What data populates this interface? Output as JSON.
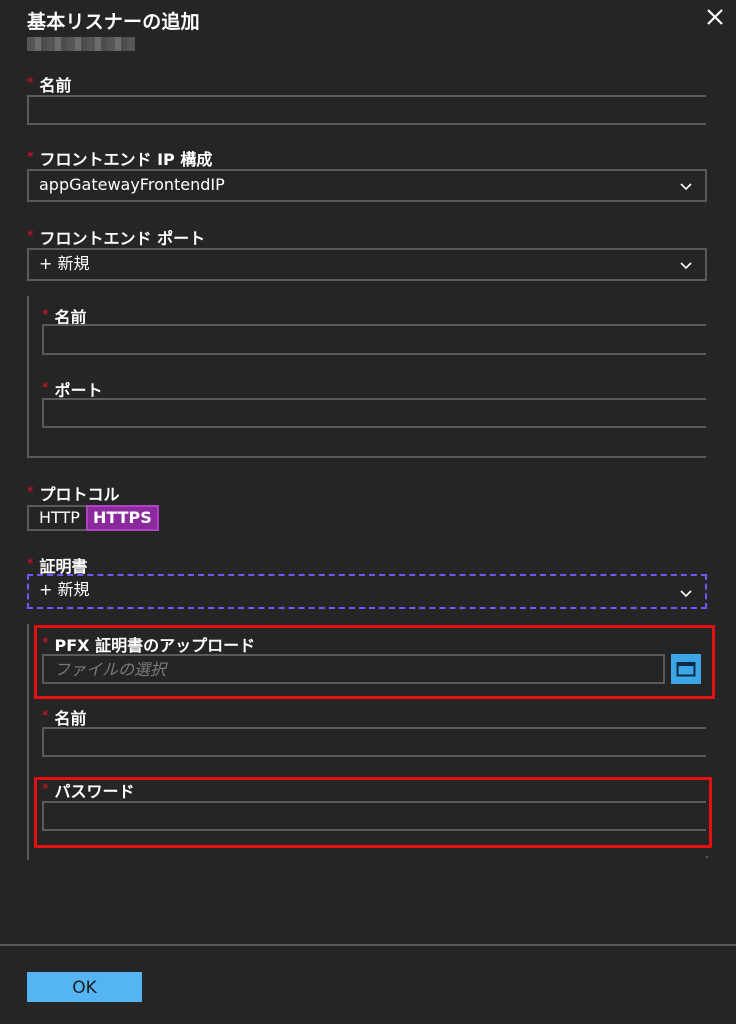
{
  "blade": {
    "title": "基本リスナーの追加",
    "close_label": "✕"
  },
  "fields": {
    "required_mark": "*",
    "name_label": "名前",
    "name_value": "",
    "frontend_ip_label": "フロントエンド IP 構成",
    "frontend_ip_value": "appGatewayFrontendIP",
    "frontend_port_label": "フロントエンド ポート",
    "frontend_port_value": "+ 新規",
    "port_sub": {
      "name_label": "名前",
      "name_value": "",
      "port_label": "ポート",
      "port_value": ""
    },
    "protocol_label": "プロトコル",
    "protocol_options": [
      "HTTP",
      "HTTPS"
    ],
    "protocol_selected": "HTTPS",
    "cert_label": "証明書",
    "cert_value": "+ 新規",
    "cert_sub": {
      "pfx_label": "PFX 証明書のアップロード",
      "pfx_placeholder": "ファイルの選択",
      "name_label": "名前",
      "name_value": "",
      "password_label": "パスワード",
      "password_value": ""
    }
  },
  "footer": {
    "ok_label": "OK"
  },
  "colors": {
    "background": "#252526",
    "accent": "#55b4f4",
    "selected_toggle": "#8a2a9c",
    "highlight": "#e30f13",
    "required": "#e81123"
  }
}
